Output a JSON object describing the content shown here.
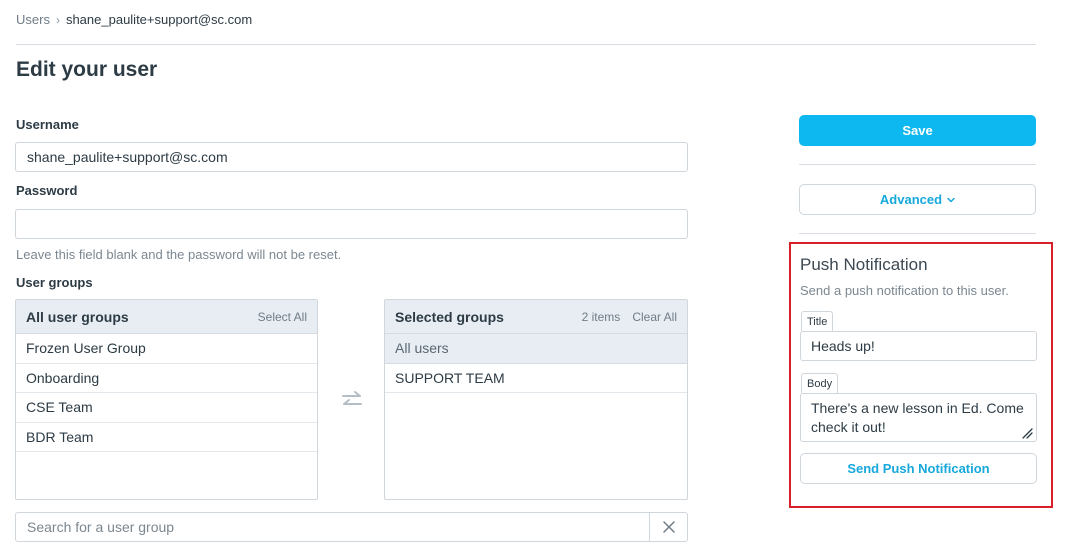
{
  "breadcrumb": {
    "parent": "Users",
    "separator": "›",
    "current": "shane_paulite+support@sc.com"
  },
  "page": {
    "title": "Edit your user"
  },
  "form": {
    "username_label": "Username",
    "username_value": "shane_paulite+support@sc.com",
    "password_label": "Password",
    "password_value": "",
    "password_hint": "Leave this field blank and the password will not be reset.",
    "user_groups_label": "User groups"
  },
  "groups": {
    "all": {
      "title": "All user groups",
      "select_all": "Select All",
      "items": [
        "Frozen User Group",
        "Onboarding",
        "CSE Team",
        "BDR Team"
      ]
    },
    "selected": {
      "title": "Selected groups",
      "count": "2 items",
      "clear_all": "Clear All",
      "items": [
        "All users",
        "SUPPORT TEAM"
      ]
    },
    "search_placeholder": "Search for a user group",
    "clear_icon": "close-icon",
    "swap_icon": "swap-arrows-icon"
  },
  "sidebar": {
    "save_label": "Save",
    "advanced_label": "Advanced",
    "advanced_icon": "chevron-down-icon"
  },
  "push": {
    "title": "Push Notification",
    "description": "Send a push notification to this user.",
    "title_label": "Title",
    "title_value": "Heads up!",
    "body_label": "Body",
    "body_value": "There's a new lesson in Ed. Come check it out!",
    "send_label": "Send Push Notification"
  },
  "colors": {
    "primary": "#0db7f0",
    "link": "#17a8dc",
    "highlight_border": "#d8202a",
    "header_bg": "#e8edf3"
  }
}
